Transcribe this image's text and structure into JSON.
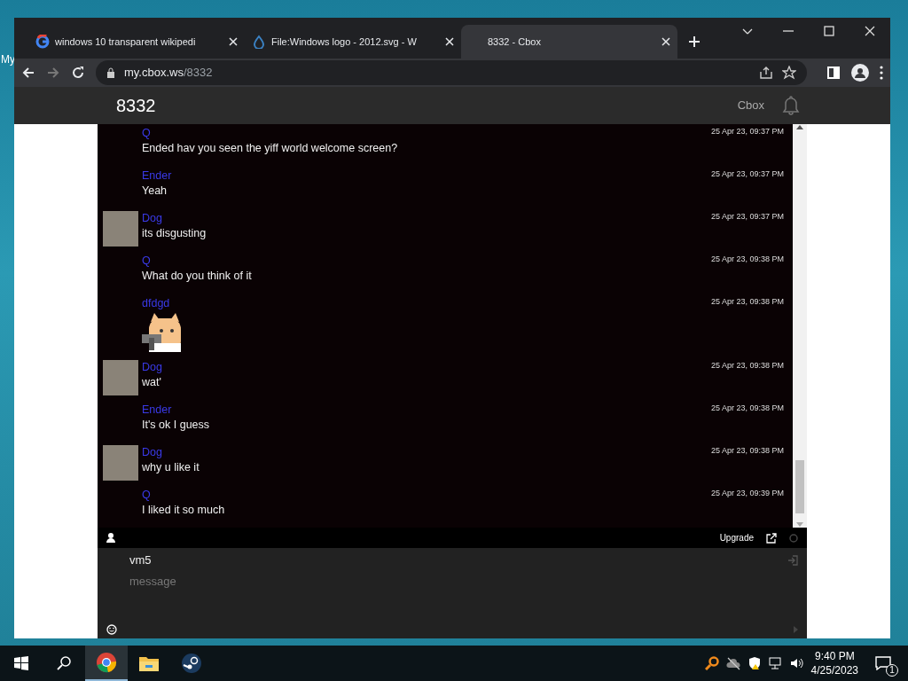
{
  "desktop": {
    "icon_label": "My"
  },
  "browser": {
    "tabs": [
      {
        "title": "windows 10 transparent wikipedi",
        "selected": false
      },
      {
        "title": "File:Windows logo - 2012.svg - W",
        "selected": false
      },
      {
        "title": "8332 - Cbox",
        "selected": true
      }
    ],
    "address": {
      "host": "my.cbox.ws",
      "path": "/8332"
    }
  },
  "site_header": {
    "title": "8332",
    "link": "Cbox"
  },
  "messages": [
    {
      "name": "Q",
      "time": "25 Apr 23, 09:37 PM",
      "kind": "text",
      "text": "Ended hav you seen the yiff world welcome screen?",
      "avatar": false
    },
    {
      "name": "Ender",
      "time": "25 Apr 23, 09:37 PM",
      "kind": "text",
      "text": "Yeah",
      "avatar": false
    },
    {
      "name": "Dog",
      "time": "25 Apr 23, 09:37 PM",
      "kind": "text",
      "text": "its disgusting",
      "avatar": true
    },
    {
      "name": "Q",
      "time": "25 Apr 23, 09:38 PM",
      "kind": "text",
      "text": "What do you think of it",
      "avatar": false
    },
    {
      "name": "dfdgd",
      "time": "25 Apr 23, 09:38 PM",
      "kind": "image",
      "avatar": false
    },
    {
      "name": "Dog",
      "time": "25 Apr 23, 09:38 PM",
      "kind": "text",
      "text": "wat'",
      "avatar": true
    },
    {
      "name": "Ender",
      "time": "25 Apr 23, 09:38 PM",
      "kind": "text",
      "text": "It's ok I guess",
      "avatar": false
    },
    {
      "name": "Dog",
      "time": "25 Apr 23, 09:38 PM",
      "kind": "text",
      "text": "why u like it",
      "avatar": true
    },
    {
      "name": "Q",
      "time": "25 Apr 23, 09:39 PM",
      "kind": "text",
      "text": "I liked it so much",
      "avatar": false
    }
  ],
  "toolbar": {
    "upgrade": "Upgrade"
  },
  "compose": {
    "name_value": "vm5",
    "placeholder": "message"
  },
  "taskbar": {
    "apps": [
      {
        "selected": true
      },
      {
        "selected": false
      },
      {
        "selected": false
      }
    ],
    "time": "9:40 PM",
    "date": "4/25/2023",
    "notifications": "1"
  }
}
